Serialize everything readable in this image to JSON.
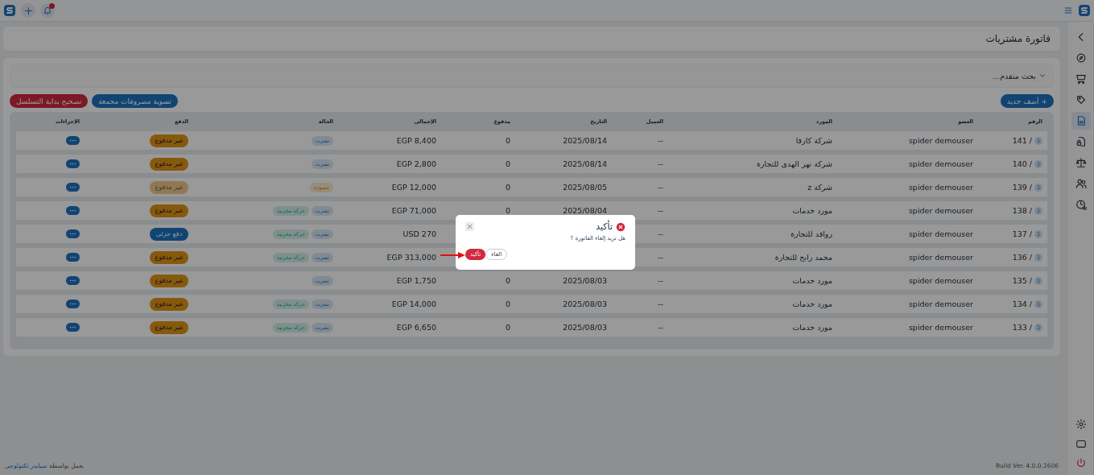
{
  "top_bar": {
    "notifications_unread": true
  },
  "sidebar": {
    "items": [
      {
        "selected": false
      },
      {
        "selected": false
      },
      {
        "selected": false
      },
      {
        "selected": true
      },
      {
        "selected": false
      },
      {
        "selected": false
      },
      {
        "selected": false
      },
      {
        "selected": false
      }
    ]
  },
  "page_title": "فاتورة مشتريات",
  "advanced_search": "بحث متقدم...",
  "add_button": "+ أضف جديد",
  "bulk_buttons": [
    {
      "label": "تسوية مصروفات مجمعة",
      "kind": "primary"
    },
    {
      "label": "تصحيح بداية التسلسل",
      "kind": "danger"
    }
  ],
  "table": {
    "columns": [
      "الرقم",
      "العضو",
      "المورد",
      "العميل",
      "التاريخ",
      "مدفوع",
      "الإجمالى",
      "الحالة",
      "الدفع",
      "الإجراءات"
    ],
    "rows": [
      {
        "version": "1",
        "number": "141 /",
        "member": "spider demouser",
        "supplier": "شركة كارفا",
        "client": "--",
        "date": "2025/08/14",
        "paid": "0",
        "total": "EGP 8,400",
        "tags": [
          {
            "label": "نشرت",
            "kind": "published"
          }
        ],
        "payment": {
          "label": "غير مدفوع",
          "kind": "unpaid",
          "faded": false
        }
      },
      {
        "version": "1",
        "number": "140 /",
        "member": "spider demouser",
        "supplier": "شركة نهر الهدى للتجارة",
        "client": "--",
        "date": "2025/08/14",
        "paid": "0",
        "total": "EGP 2,800",
        "tags": [
          {
            "label": "نشرت",
            "kind": "published"
          }
        ],
        "payment": {
          "label": "غير مدفوع",
          "kind": "unpaid",
          "faded": false
        }
      },
      {
        "version": "1",
        "number": "139 /",
        "member": "spider demouser",
        "supplier": "شركة z",
        "client": "--",
        "date": "2025/08/05",
        "paid": "0",
        "total": "EGP 12,000",
        "tags": [
          {
            "label": "مسودة",
            "kind": "draft"
          }
        ],
        "payment": {
          "label": "غير مدفوع",
          "kind": "unpaid",
          "faded": true
        }
      },
      {
        "version": "1",
        "number": "138 /",
        "member": "spider demouser",
        "supplier": "مورد خدمات",
        "client": "--",
        "date": "2025/08/04",
        "paid": "0",
        "total": "EGP 71,000",
        "tags": [
          {
            "label": "نشرت",
            "kind": "published"
          },
          {
            "label": "حركة مخزنية",
            "kind": "stock"
          }
        ],
        "payment": {
          "label": "غير مدفوع",
          "kind": "unpaid",
          "faded": false
        }
      },
      {
        "version": "1",
        "number": "137 /",
        "member": "spider demouser",
        "supplier": "روافد للتجارة",
        "client": "--",
        "total": "USD 270",
        "tags": [
          {
            "label": "نشرت",
            "kind": "published"
          },
          {
            "label": "حركة مخزنية",
            "kind": "stock"
          }
        ],
        "payment": {
          "label": "دفع جزئى",
          "kind": "partial",
          "faded": false
        }
      },
      {
        "version": "1",
        "number": "136 /",
        "member": "spider demouser",
        "supplier": "محمد رابح للتجارة",
        "client": "--",
        "total": "EGP 313,000",
        "tags": [
          {
            "label": "نشرت",
            "kind": "published"
          },
          {
            "label": "حركة مخزنية",
            "kind": "stock"
          }
        ],
        "payment": {
          "label": "غير مدفوع",
          "kind": "unpaid",
          "faded": false
        }
      },
      {
        "version": "1",
        "number": "135 /",
        "member": "spider demouser",
        "supplier": "مورد خدمات",
        "client": "--",
        "date": "2025/08/03",
        "paid": "0",
        "total": "EGP 1,750",
        "tags": [
          {
            "label": "نشرت",
            "kind": "published"
          }
        ],
        "payment": {
          "label": "غير مدفوع",
          "kind": "unpaid",
          "faded": false
        }
      },
      {
        "version": "1",
        "number": "134 /",
        "member": "spider demouser",
        "supplier": "مورد خدمات",
        "client": "--",
        "date": "2025/08/03",
        "paid": "0",
        "total": "EGP 14,000",
        "tags": [
          {
            "label": "نشرت",
            "kind": "published"
          },
          {
            "label": "حركة مخزنية",
            "kind": "stock"
          }
        ],
        "payment": {
          "label": "غير مدفوع",
          "kind": "unpaid",
          "faded": false
        }
      },
      {
        "version": "1",
        "number": "133 /",
        "member": "spider demouser",
        "supplier": "مورد خدمات",
        "client": "--",
        "date": "2025/08/03",
        "paid": "0",
        "total": "EGP 6,650",
        "tags": [
          {
            "label": "نشرت",
            "kind": "published"
          },
          {
            "label": "حركة مخزنية",
            "kind": "stock"
          }
        ],
        "payment": {
          "label": "غير مدفوع",
          "kind": "unpaid",
          "faded": false
        }
      }
    ]
  },
  "modal": {
    "title": "تأكيد",
    "message": "هل تريد إلغاء الفاتورة ؟",
    "buttons": [
      {
        "label": "الغاء",
        "kind": "secondary"
      },
      {
        "label": "تأكيد",
        "kind": "danger"
      }
    ]
  },
  "footer": {
    "credit_text": "يعمل بواسطة",
    "credit_link": "سبايدر تكنولوجى",
    "build": "Build Ver. 4.0.0.2606"
  }
}
